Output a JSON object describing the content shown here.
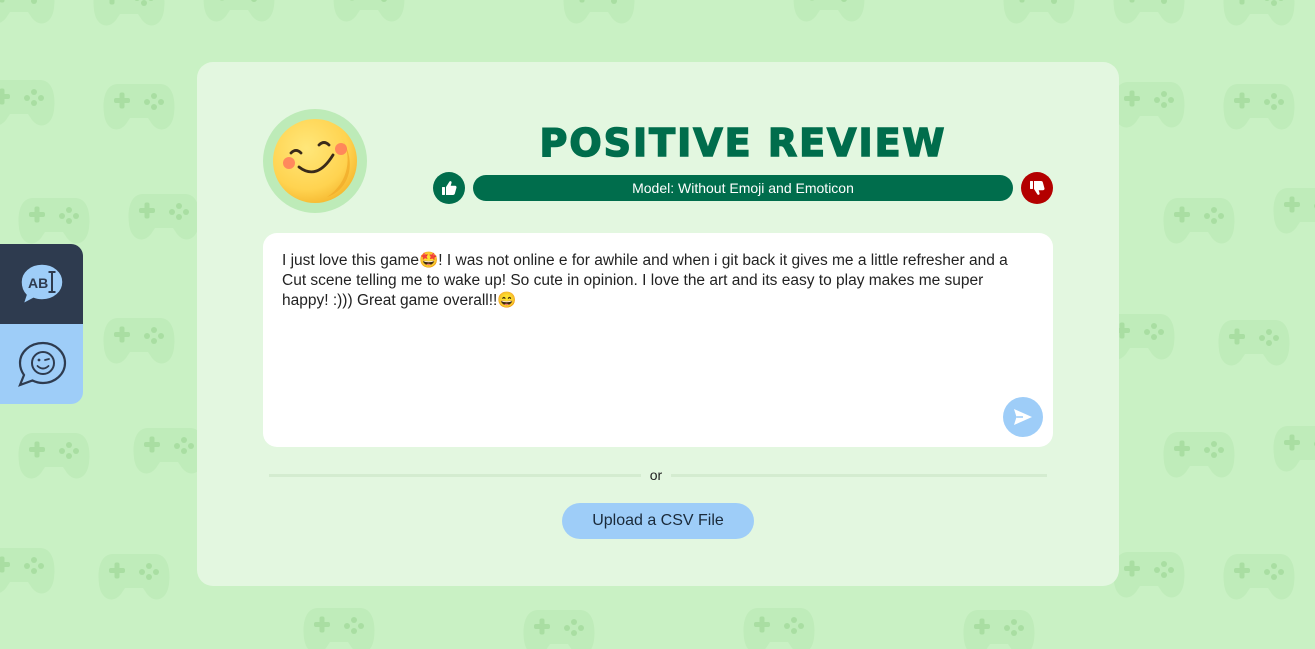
{
  "title": "POSITIVE REVIEW",
  "model_label": "Model: Without Emoji and Emoticon",
  "review_text": "I just love this game🤩! I was not online e for awhile and when i git back it gives me a little refresher and a Cut scene telling me to wake up! So cute in opinion. I love the art and its easy to play makes me super happy! :))) Great game overall!!😄",
  "divider_text": "or",
  "upload_label": "Upload a CSV File",
  "side_tabs": {
    "text_tab_badge": "AB"
  },
  "colors": {
    "background": "#c9f1c4",
    "card": "#e3f7e0",
    "primary_green": "#006d4c",
    "negative_red": "#b30000",
    "accent_blue": "#9ecdf8",
    "dark_tab": "#2e3b4f"
  },
  "icons": {
    "header": "smiley-face-icon",
    "positive": "thumbs-up-icon",
    "negative": "thumbs-down-icon",
    "send": "send-icon",
    "text_tab": "text-bubble-icon",
    "emoji_tab": "emoji-bubble-icon",
    "background": "gamepad-icon"
  }
}
